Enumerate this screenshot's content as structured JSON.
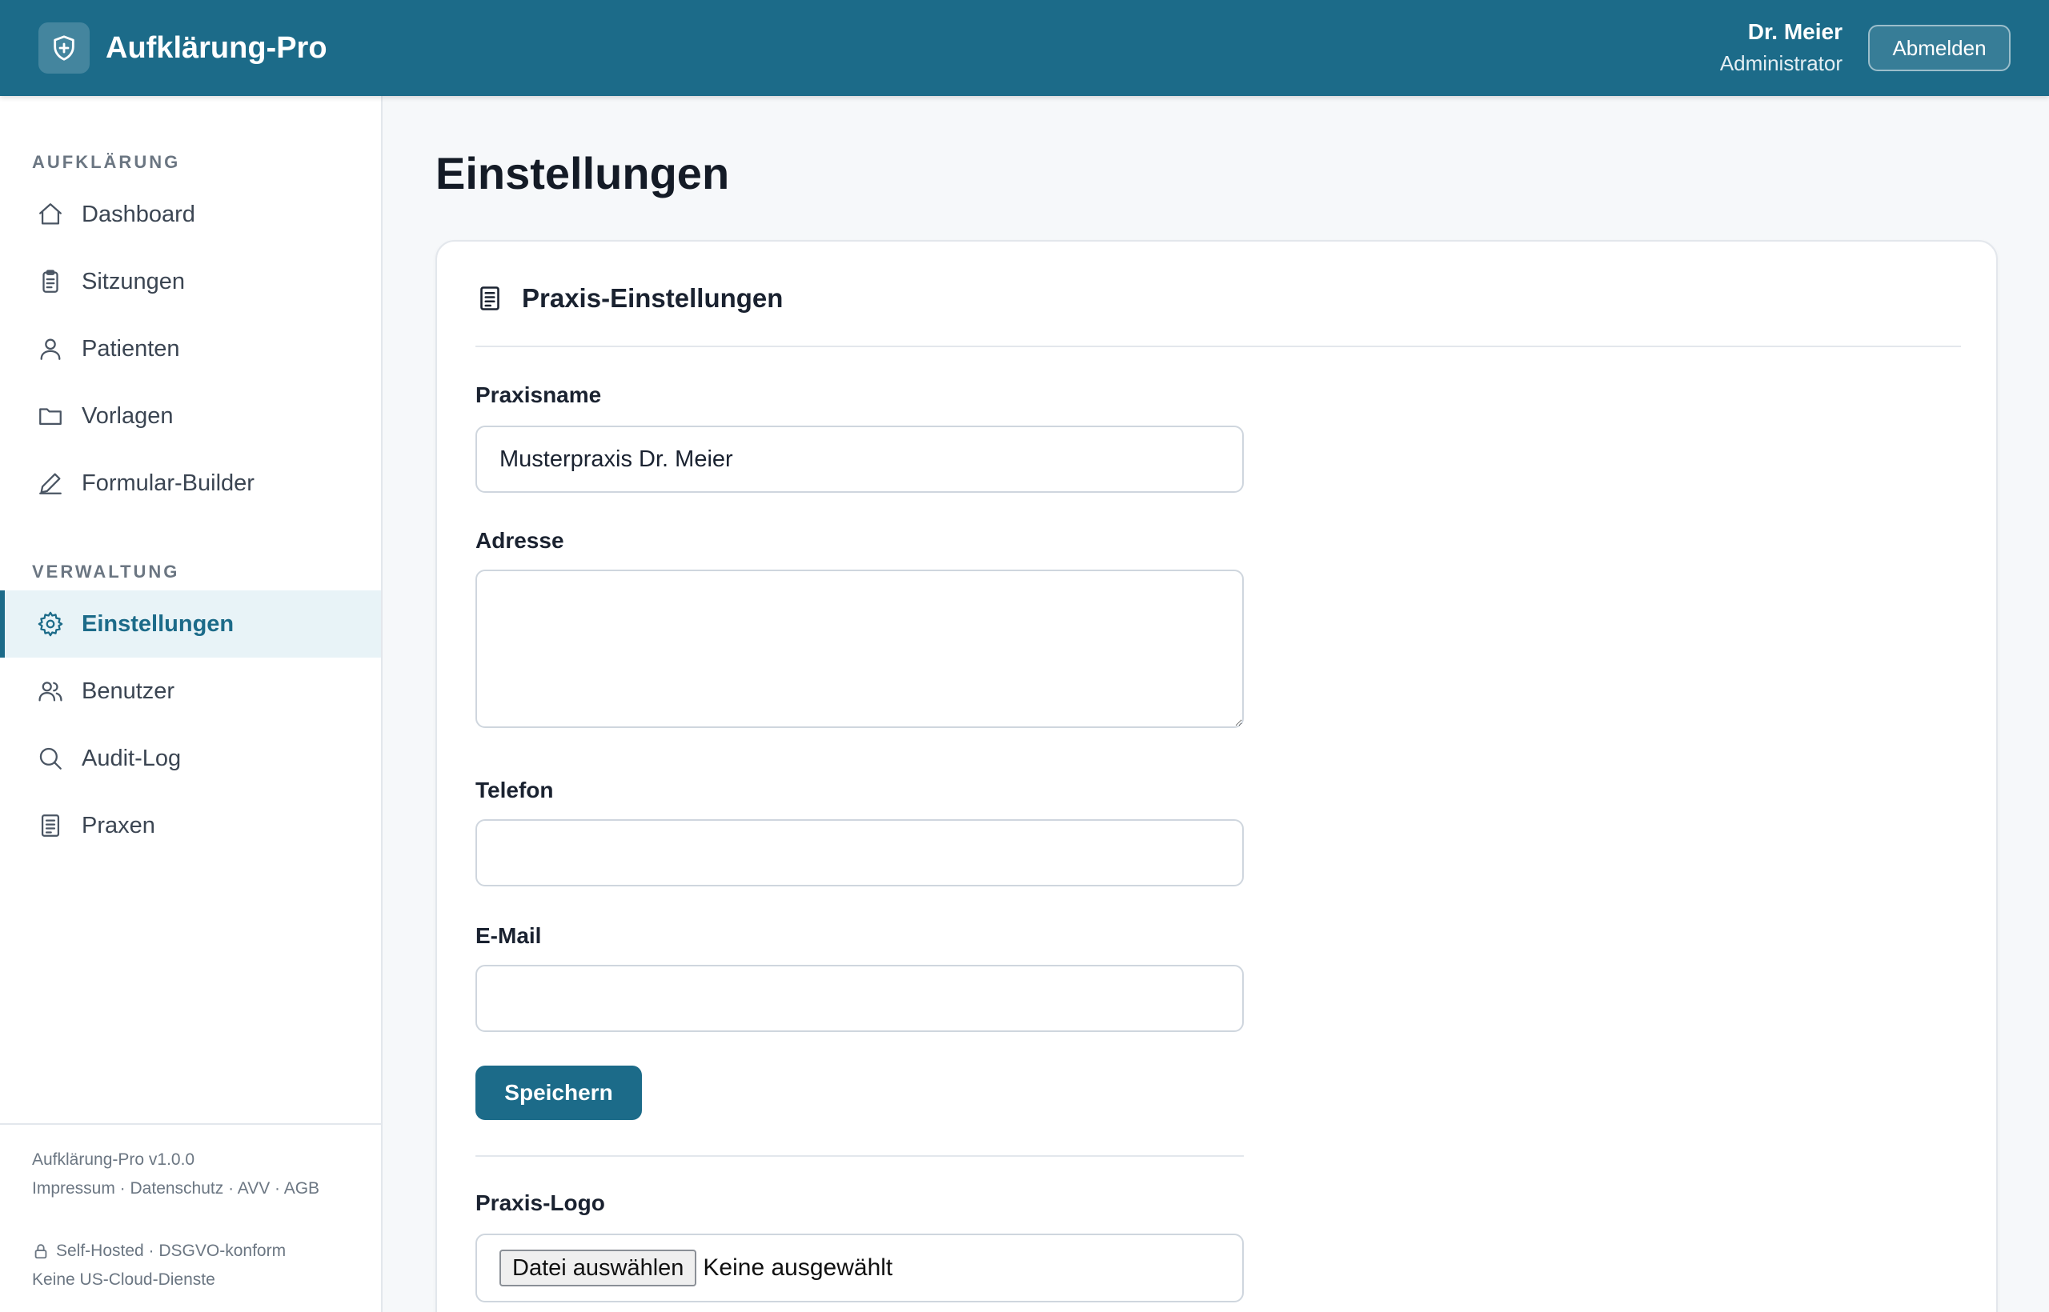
{
  "header": {
    "app_title": "Aufklärung-Pro",
    "user_name": "Dr. Meier",
    "user_role": "Administrator",
    "logout_label": "Abmelden"
  },
  "sidebar": {
    "section_main": "AUFKLÄRUNG",
    "section_admin": "VERWALTUNG",
    "items": [
      {
        "label": "Dashboard",
        "icon": "home-icon"
      },
      {
        "label": "Sitzungen",
        "icon": "clipboard-icon"
      },
      {
        "label": "Patienten",
        "icon": "user-icon"
      },
      {
        "label": "Vorlagen",
        "icon": "folder-icon"
      },
      {
        "label": "Formular-Builder",
        "icon": "pen-icon"
      },
      {
        "label": "Einstellungen",
        "icon": "gear-icon",
        "active": true
      },
      {
        "label": "Benutzer",
        "icon": "users-icon"
      },
      {
        "label": "Audit-Log",
        "icon": "search-icon"
      },
      {
        "label": "Praxen",
        "icon": "document-icon"
      }
    ],
    "footer": {
      "version": "Aufklärung-Pro v1.0.0",
      "links": "Impressum · Datenschutz · AVV · AGB",
      "hosting": "Self-Hosted · DSGVO-konform",
      "cloud_note": "Keine US-Cloud-Dienste"
    }
  },
  "main": {
    "page_title": "Einstellungen",
    "card_title": "Praxis-Einstellungen",
    "fields": {
      "praxisname": {
        "label": "Praxisname",
        "value": "Musterpraxis Dr. Meier"
      },
      "adresse": {
        "label": "Adresse",
        "value": ""
      },
      "telefon": {
        "label": "Telefon",
        "value": ""
      },
      "email": {
        "label": "E-Mail",
        "value": ""
      }
    },
    "save_label": "Speichern",
    "logo": {
      "label": "Praxis-Logo",
      "button_label": "Datei auswählen",
      "status": "Keine ausgewählt"
    }
  },
  "colors": {
    "brand": "#1c6b89",
    "active_bg": "#e8f3f7"
  }
}
